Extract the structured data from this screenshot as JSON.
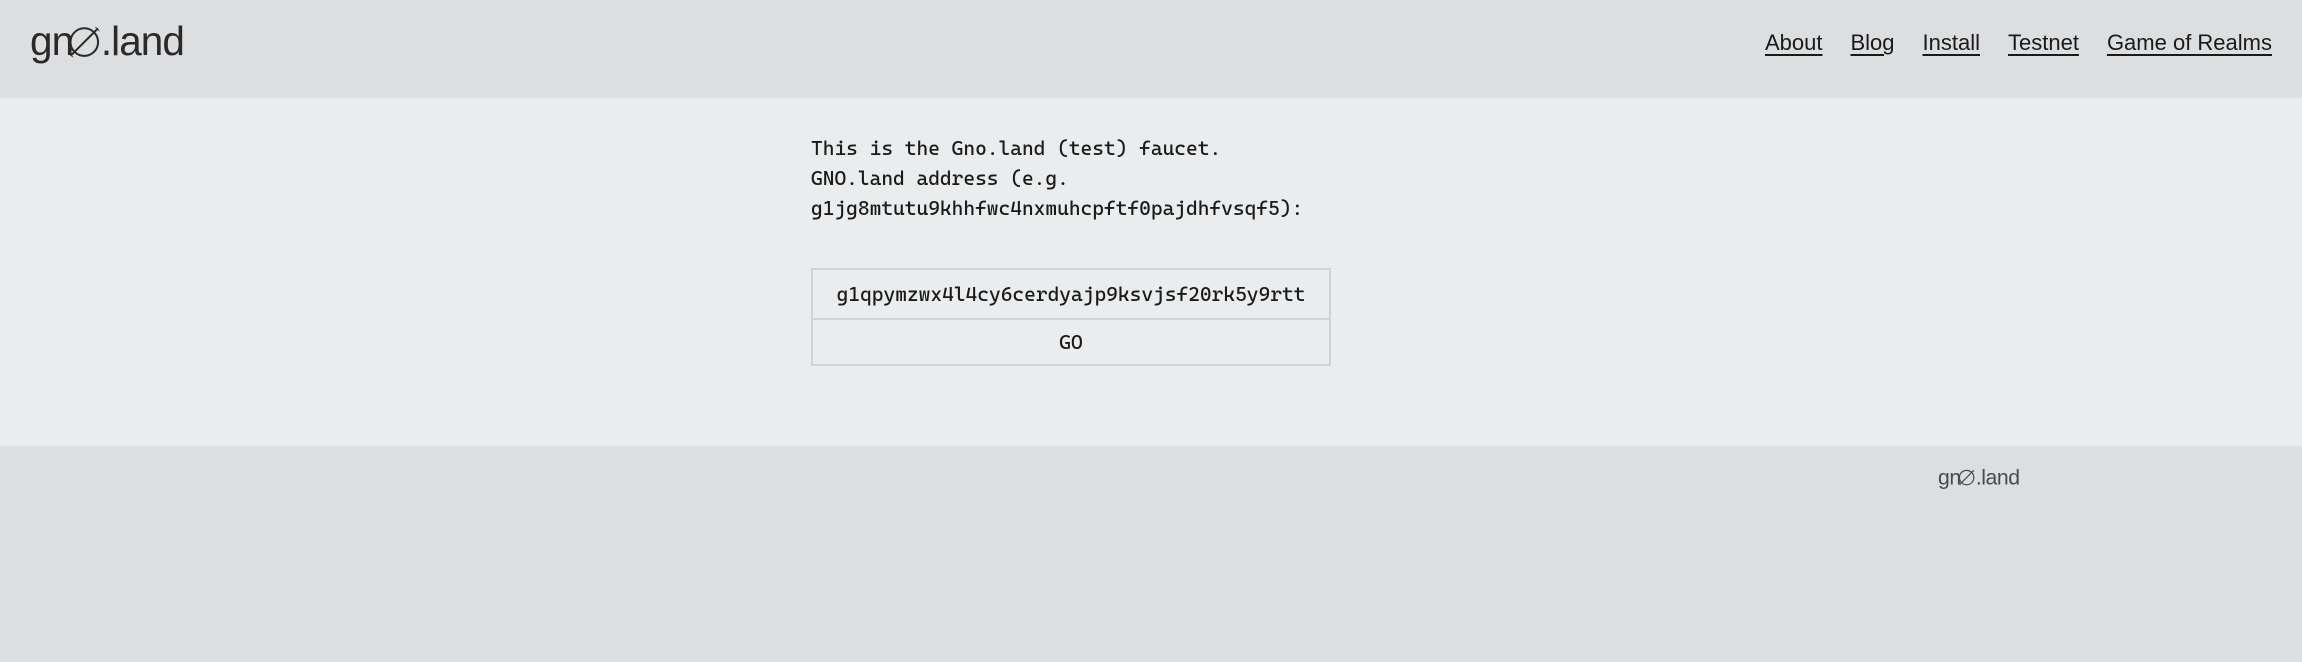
{
  "brand": {
    "name": "gno.land"
  },
  "nav": {
    "items": [
      {
        "label": "About"
      },
      {
        "label": "Blog"
      },
      {
        "label": "Install"
      },
      {
        "label": "Testnet"
      },
      {
        "label": "Game of Realms"
      }
    ]
  },
  "main": {
    "line1": "This is the Gno.land (test) faucet.",
    "line2": "GNO.land address (e.g. g1jg8mtutu9khhfwc4nxmuhcpftf0pajdhfvsqf5):",
    "address_value": "g1qpymzwx4l4cy6cerdyajp9ksvjsf20rk5y9rtt",
    "address_placeholder": "",
    "submit_label": "GO"
  }
}
